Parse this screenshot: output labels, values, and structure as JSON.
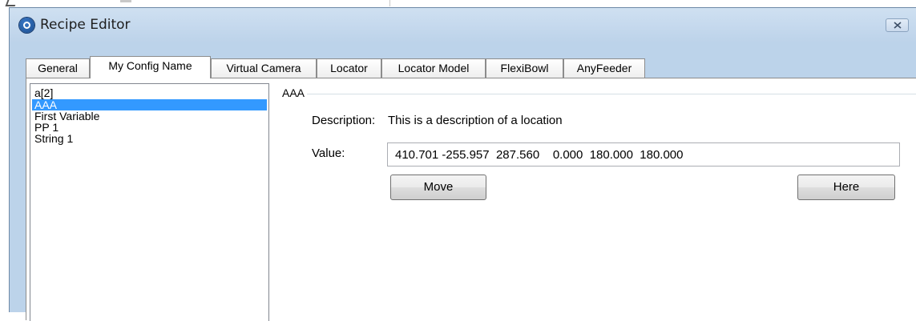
{
  "window": {
    "title": "Recipe Editor"
  },
  "tabs": [
    {
      "label": "General",
      "active": false
    },
    {
      "label": "My Config Name",
      "active": true
    },
    {
      "label": "Virtual Camera",
      "active": false
    },
    {
      "label": "Locator",
      "active": false
    },
    {
      "label": "Locator Model",
      "active": false
    },
    {
      "label": "FlexiBowl",
      "active": false
    },
    {
      "label": "AnyFeeder",
      "active": false
    }
  ],
  "variables": [
    {
      "label": "a[2]",
      "selected": false
    },
    {
      "label": "AAA",
      "selected": true
    },
    {
      "label": "First Variable",
      "selected": false
    },
    {
      "label": "PP 1",
      "selected": false
    },
    {
      "label": "String 1",
      "selected": false
    }
  ],
  "detail": {
    "group_title": "AAA",
    "description_label": "Description:",
    "description_value": "This is a description of a location",
    "value_label": "Value:",
    "value": "410.701 -255.957  287.560    0.000  180.000  180.000",
    "move_label": "Move",
    "here_label": "Here"
  },
  "colors": {
    "selection": "#3399ff",
    "window_frame": "#bcd3ea"
  },
  "icons": {
    "app": "app-logo-icon",
    "close": "close-icon"
  }
}
